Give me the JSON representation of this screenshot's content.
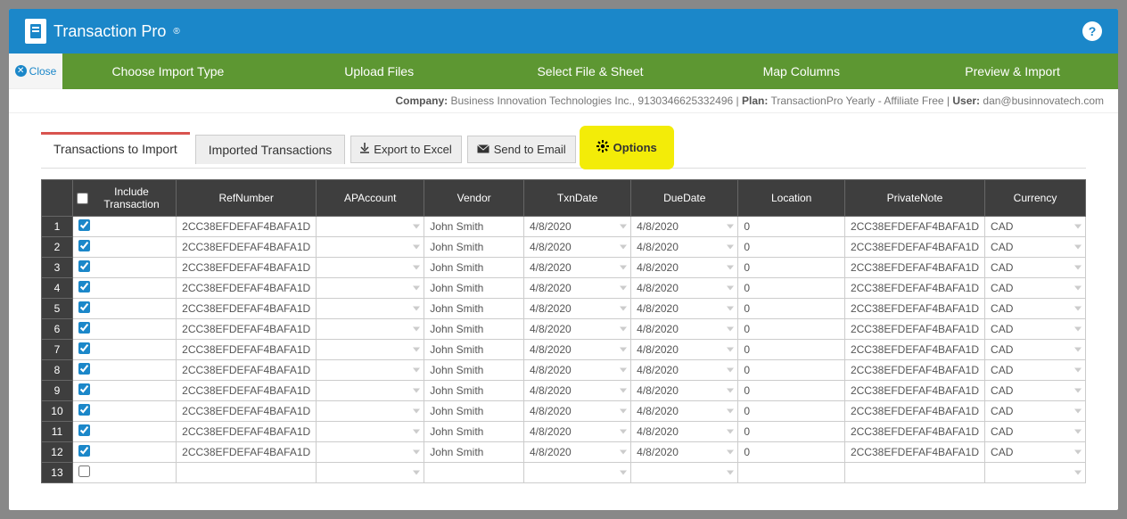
{
  "brand": {
    "name": "Transaction Pro"
  },
  "help_tooltip": "?",
  "close_label": "Close",
  "steps": [
    "Choose Import Type",
    "Upload Files",
    "Select File & Sheet",
    "Map Columns",
    "Preview & Import"
  ],
  "meta": {
    "company_label": "Company:",
    "company_value": "Business Innovation Technologies Inc., 9130346625332496",
    "plan_label": "Plan:",
    "plan_value": "TransactionPro Yearly - Affiliate Free",
    "user_label": "User:",
    "user_value": "dan@businnovatech.com"
  },
  "tabs": {
    "active": "Transactions to Import",
    "inactive": "Imported Transactions"
  },
  "toolbar": {
    "export": "Export to Excel",
    "send": "Send to Email",
    "options": "Options"
  },
  "grid": {
    "include_header": "Include Transaction",
    "columns": [
      "RefNumber",
      "APAccount",
      "Vendor",
      "TxnDate",
      "DueDate",
      "Location",
      "PrivateNote",
      "Currency"
    ],
    "rows": [
      {
        "n": 1,
        "checked": true,
        "ref": "2CC38EFDEFAF4BAFA1D",
        "ap": "",
        "vendor": "John Smith",
        "txn": "4/8/2020",
        "due": "4/8/2020",
        "loc": "0",
        "note": "2CC38EFDEFAF4BAFA1D",
        "cur": "CAD"
      },
      {
        "n": 2,
        "checked": true,
        "ref": "2CC38EFDEFAF4BAFA1D",
        "ap": "",
        "vendor": "John Smith",
        "txn": "4/8/2020",
        "due": "4/8/2020",
        "loc": "0",
        "note": "2CC38EFDEFAF4BAFA1D",
        "cur": "CAD"
      },
      {
        "n": 3,
        "checked": true,
        "ref": "2CC38EFDEFAF4BAFA1D",
        "ap": "",
        "vendor": "John Smith",
        "txn": "4/8/2020",
        "due": "4/8/2020",
        "loc": "0",
        "note": "2CC38EFDEFAF4BAFA1D",
        "cur": "CAD"
      },
      {
        "n": 4,
        "checked": true,
        "ref": "2CC38EFDEFAF4BAFA1D",
        "ap": "",
        "vendor": "John Smith",
        "txn": "4/8/2020",
        "due": "4/8/2020",
        "loc": "0",
        "note": "2CC38EFDEFAF4BAFA1D",
        "cur": "CAD"
      },
      {
        "n": 5,
        "checked": true,
        "ref": "2CC38EFDEFAF4BAFA1D",
        "ap": "",
        "vendor": "John Smith",
        "txn": "4/8/2020",
        "due": "4/8/2020",
        "loc": "0",
        "note": "2CC38EFDEFAF4BAFA1D",
        "cur": "CAD"
      },
      {
        "n": 6,
        "checked": true,
        "ref": "2CC38EFDEFAF4BAFA1D",
        "ap": "",
        "vendor": "John Smith",
        "txn": "4/8/2020",
        "due": "4/8/2020",
        "loc": "0",
        "note": "2CC38EFDEFAF4BAFA1D",
        "cur": "CAD"
      },
      {
        "n": 7,
        "checked": true,
        "ref": "2CC38EFDEFAF4BAFA1D",
        "ap": "",
        "vendor": "John Smith",
        "txn": "4/8/2020",
        "due": "4/8/2020",
        "loc": "0",
        "note": "2CC38EFDEFAF4BAFA1D",
        "cur": "CAD"
      },
      {
        "n": 8,
        "checked": true,
        "ref": "2CC38EFDEFAF4BAFA1D",
        "ap": "",
        "vendor": "John Smith",
        "txn": "4/8/2020",
        "due": "4/8/2020",
        "loc": "0",
        "note": "2CC38EFDEFAF4BAFA1D",
        "cur": "CAD"
      },
      {
        "n": 9,
        "checked": true,
        "ref": "2CC38EFDEFAF4BAFA1D",
        "ap": "",
        "vendor": "John Smith",
        "txn": "4/8/2020",
        "due": "4/8/2020",
        "loc": "0",
        "note": "2CC38EFDEFAF4BAFA1D",
        "cur": "CAD"
      },
      {
        "n": 10,
        "checked": true,
        "ref": "2CC38EFDEFAF4BAFA1D",
        "ap": "",
        "vendor": "John Smith",
        "txn": "4/8/2020",
        "due": "4/8/2020",
        "loc": "0",
        "note": "2CC38EFDEFAF4BAFA1D",
        "cur": "CAD"
      },
      {
        "n": 11,
        "checked": true,
        "ref": "2CC38EFDEFAF4BAFA1D",
        "ap": "",
        "vendor": "John Smith",
        "txn": "4/8/2020",
        "due": "4/8/2020",
        "loc": "0",
        "note": "2CC38EFDEFAF4BAFA1D",
        "cur": "CAD"
      },
      {
        "n": 12,
        "checked": true,
        "ref": "2CC38EFDEFAF4BAFA1D",
        "ap": "",
        "vendor": "John Smith",
        "txn": "4/8/2020",
        "due": "4/8/2020",
        "loc": "0",
        "note": "2CC38EFDEFAF4BAFA1D",
        "cur": "CAD"
      },
      {
        "n": 13,
        "checked": false,
        "ref": "",
        "ap": "",
        "vendor": "",
        "txn": "",
        "due": "",
        "loc": "",
        "note": "",
        "cur": ""
      }
    ]
  }
}
